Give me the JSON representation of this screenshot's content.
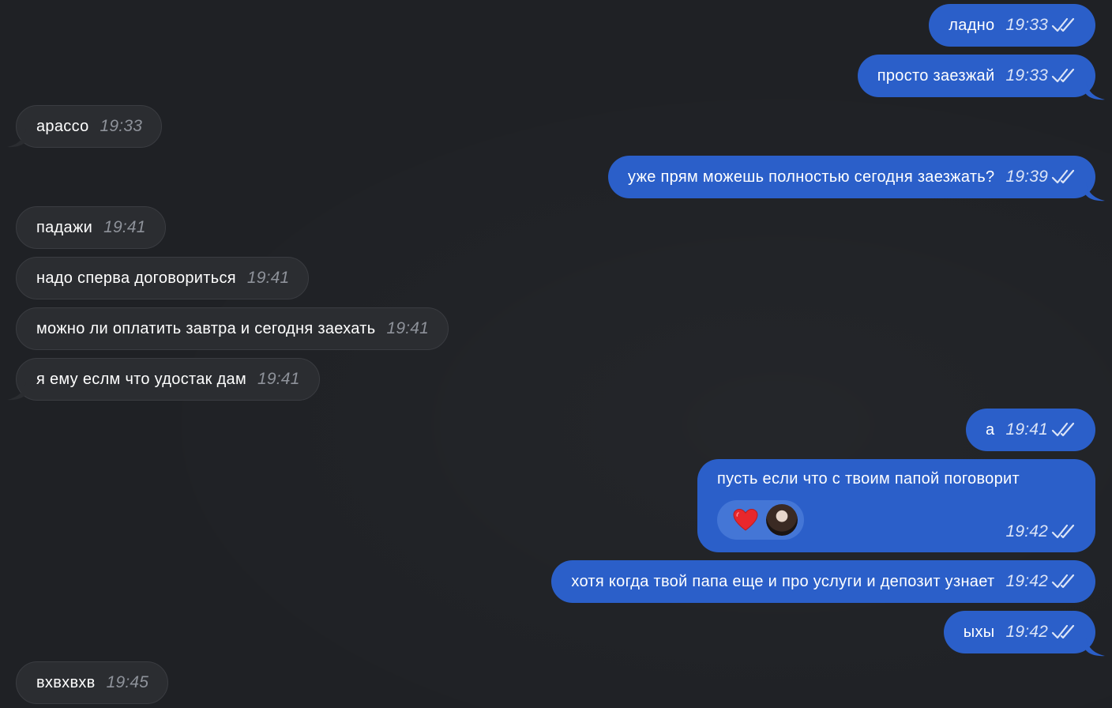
{
  "theme": {
    "background": "#1f2125",
    "incoming_bubble": "#2b2d31",
    "outgoing_bubble": "#2b5fc9",
    "reaction_pill": "#4476d6"
  },
  "messages": [
    {
      "dir": "out",
      "text": "ладно",
      "time": "19:33",
      "status": "read-double-check"
    },
    {
      "dir": "out",
      "text": "просто заезжай",
      "time": "19:33",
      "status": "read-double-check"
    },
    {
      "dir": "in",
      "text": "арассо",
      "time": "19:33"
    },
    {
      "dir": "out",
      "text": "уже прям можешь полностью сегодня заезжать?",
      "time": "19:39",
      "status": "read-double-check"
    },
    {
      "dir": "in",
      "text": "падажи",
      "time": "19:41"
    },
    {
      "dir": "in",
      "text": "надо сперва договориться",
      "time": "19:41"
    },
    {
      "dir": "in",
      "text": "можно ли оплатить завтра и сегодня заехать",
      "time": "19:41"
    },
    {
      "dir": "in",
      "text": "я ему еслм что удостак дам",
      "time": "19:41"
    },
    {
      "dir": "out",
      "text": "а",
      "time": "19:41",
      "status": "read-double-check"
    },
    {
      "dir": "out",
      "text": "пусть если что с твоим папой поговорит",
      "time": "19:42",
      "status": "read-double-check",
      "reaction": {
        "emoji": "heart-icon",
        "by": "avatar"
      }
    },
    {
      "dir": "out",
      "text": "хотя когда твой папа еще и про услуги и депозит узнает",
      "time": "19:42",
      "status": "read-double-check"
    },
    {
      "dir": "out",
      "text": "ыхы",
      "time": "19:42",
      "status": "read-double-check"
    },
    {
      "dir": "in",
      "text": "вхвхвхв",
      "time": "19:45"
    }
  ]
}
